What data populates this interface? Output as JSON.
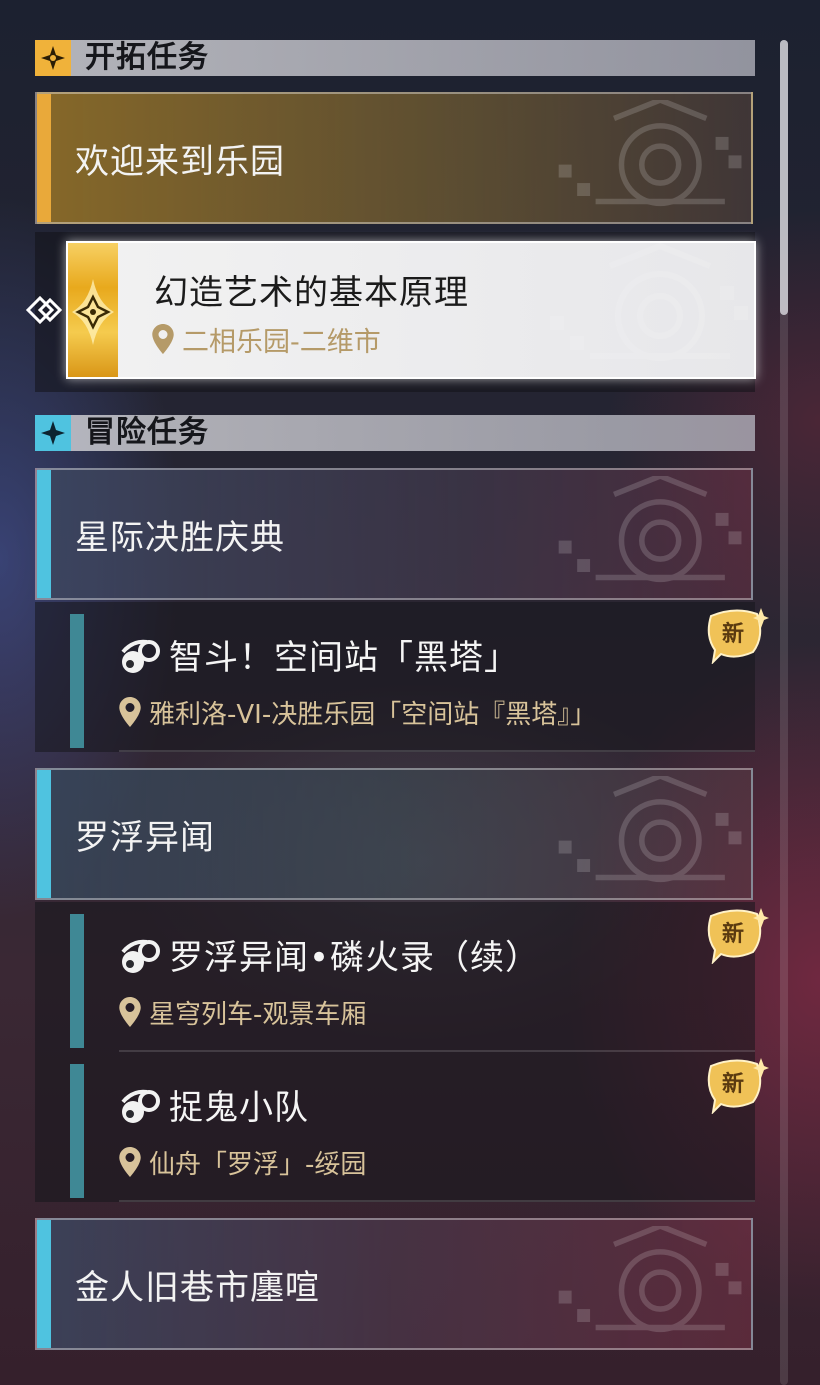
{
  "sections": {
    "trailblaze": {
      "title": "开拓任务",
      "icon": "trailblaze-icon"
    },
    "adventure": {
      "title": "冒险任务",
      "icon": "adventure-icon"
    }
  },
  "trailblaze_group": {
    "title": "欢迎来到乐园",
    "accent": "#e9a93a"
  },
  "active_quest": {
    "title": "幻造艺术的基本原理",
    "location": "二相乐园-二维市"
  },
  "adventure_groups": [
    {
      "title": "星际决胜庆典",
      "accent": "#4fc3e0"
    },
    {
      "title": "罗浮异闻",
      "accent": "#4fc3e0"
    },
    {
      "title": "金人旧巷市廛喧",
      "accent": "#4fc3e0"
    }
  ],
  "quests": [
    {
      "title": "智斗！空间站「黑塔」",
      "location": "雅利洛-VI-决胜乐园「空间站『黑塔』」",
      "badge": "新"
    },
    {
      "title": "罗浮异闻•磷火录（续）",
      "location": "星穹列车-观景车厢",
      "badge": "新"
    },
    {
      "title": "捉鬼小队",
      "location": "仙舟「罗浮」-绥园",
      "badge": "新"
    }
  ],
  "colors": {
    "gold": "#e9a93a",
    "cyan_accent": "#4fc3e0",
    "quest_bar": "#3f8895",
    "location_text": "#d8c39a"
  }
}
